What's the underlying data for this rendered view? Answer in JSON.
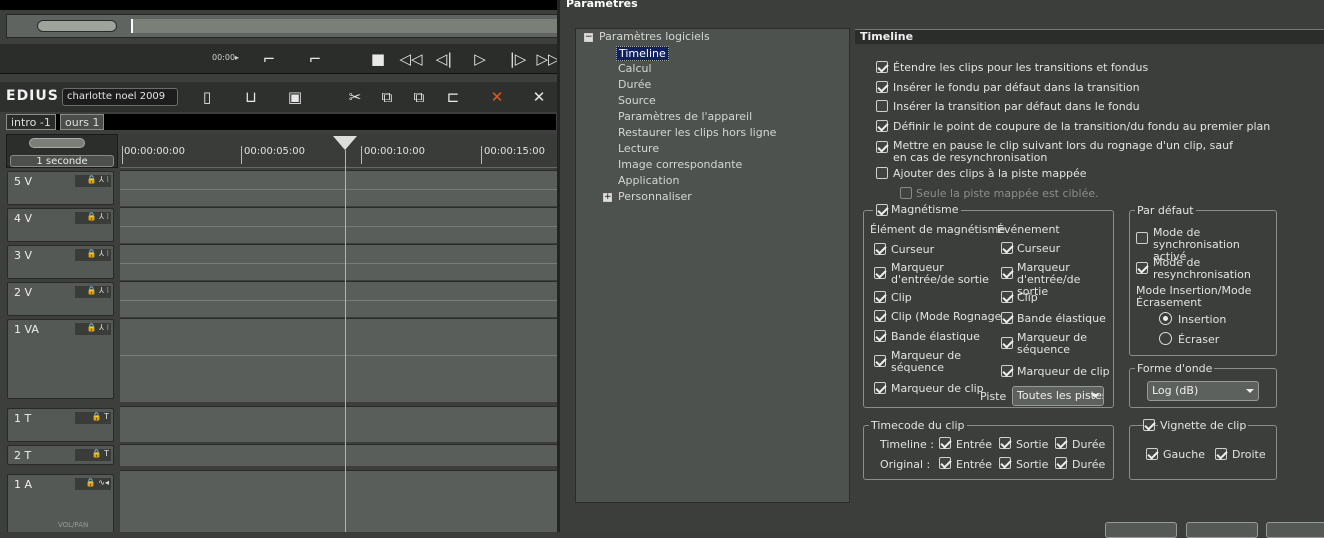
{
  "editor": {
    "timecode_small": "00:00▸",
    "logo": "EDIUS",
    "project_name": "charlotte noel 2009",
    "sequence_tabs": [
      "intro -1",
      "ours 1"
    ],
    "zoom": "1 seconde",
    "ruler_labels": [
      "00:00:00:00",
      "00:00:05:00",
      "00:00:10:00",
      "00:00:15:00"
    ],
    "tracks": [
      {
        "name": "5 V"
      },
      {
        "name": "4 V"
      },
      {
        "name": "3 V"
      },
      {
        "name": "2 V"
      },
      {
        "name": "1 VA"
      },
      {
        "name": "1 T"
      },
      {
        "name": "2 T"
      },
      {
        "name": "1 A"
      }
    ],
    "vol_pan": "VOL/PAN"
  },
  "dialog": {
    "title": "Paramètres",
    "tree": {
      "root": "Paramètres logiciels",
      "items": [
        "Timeline",
        "Calcul",
        "Durée",
        "Source",
        "Paramètres de l'appareil",
        "Restaurer les clips hors ligne",
        "Lecture",
        "Image correspondante",
        "Application"
      ],
      "selected": "Timeline",
      "collapsed": "Personnaliser"
    },
    "panel_title": "Timeline",
    "options": [
      {
        "label": "Étendre les clips pour les transitions et fondus",
        "checked": true
      },
      {
        "label": "Insérer le fondu par défaut dans la transition",
        "checked": true
      },
      {
        "label": "Insérer la transition par défaut dans le fondu",
        "checked": false
      },
      {
        "label": "Définir le point de coupure de la transition/du fondu au premier plan",
        "checked": true
      },
      {
        "label": "Mettre en pause le clip suivant lors du rognage d'un clip, sauf en cas de resynchronisation",
        "checked": true
      },
      {
        "label": "Ajouter des clips à la piste mappée",
        "checked": false
      }
    ],
    "sub_option": {
      "label": "Seule la piste mappée est ciblée.",
      "checked": false,
      "disabled": true
    },
    "magnetism": {
      "title": "Magnétisme",
      "checked": true,
      "col1_header": "Élément de magnétisme",
      "col2_header": "Événement",
      "col1": [
        {
          "label": "Curseur",
          "checked": true
        },
        {
          "label": "Marqueur d'entrée/de sortie",
          "checked": true
        },
        {
          "label": "Clip",
          "checked": true
        },
        {
          "label": "Clip (Mode Rognage)",
          "checked": true
        },
        {
          "label": "Bande élastique",
          "checked": true
        },
        {
          "label": "Marqueur de séquence",
          "checked": true
        },
        {
          "label": "Marqueur de clip",
          "checked": true
        }
      ],
      "col2": [
        {
          "label": "Curseur",
          "checked": true
        },
        {
          "label": "Marqueur d'entrée/de sortie",
          "checked": true
        },
        {
          "label": "Clip",
          "checked": true
        },
        {
          "label": "Bande élastique",
          "checked": true
        },
        {
          "label": "Marqueur de séquence",
          "checked": true
        },
        {
          "label": "Marqueur de clip",
          "checked": true
        }
      ],
      "track_label": "Piste",
      "track_value": "Toutes les pistes"
    },
    "defaults": {
      "title": "Par défaut",
      "sync_mode": {
        "label": "Mode de synchronisation activé",
        "checked": false
      },
      "resync_mode": {
        "label": "Mode de resynchronisation",
        "checked": true
      },
      "insert_mode_label": "Mode Insertion/Mode Écrasement",
      "radios": [
        {
          "label": "Insertion",
          "selected": true
        },
        {
          "label": "Écraser",
          "selected": false
        }
      ]
    },
    "waveform": {
      "title": "Forme d'onde",
      "value": "Log (dB)"
    },
    "clip_timecode": {
      "title": "Timecode du clip",
      "rows": [
        {
          "label": "Timeline :",
          "entree": true,
          "sortie": true,
          "duree": true
        },
        {
          "label": "Original :",
          "entree": true,
          "sortie": true,
          "duree": true
        }
      ],
      "col_labels": [
        "Entrée",
        "Sortie",
        "Durée"
      ]
    },
    "thumbnail": {
      "title": "Vignette de clip",
      "checked": true,
      "left": {
        "label": "Gauche",
        "checked": true
      },
      "right": {
        "label": "Droite",
        "checked": true
      }
    }
  }
}
